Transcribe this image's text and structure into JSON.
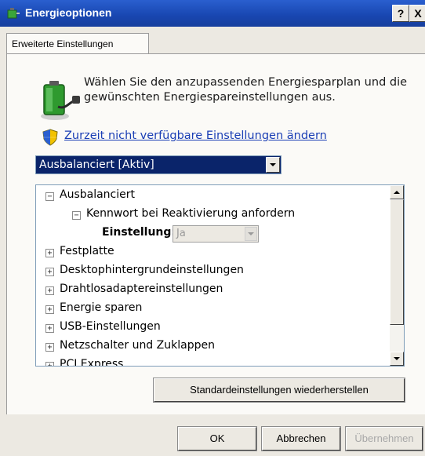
{
  "window": {
    "title": "Energieoptionen",
    "help_button": "?",
    "close_button": "X"
  },
  "tab": {
    "label": "Erweiterte Einstellungen"
  },
  "intro_text": "Wählen Sie den anzupassenden Energiesparplan und die gewünschten Energiespareinstellungen aus.",
  "link_text": "Zurzeit nicht verfügbare Einstellungen ändern",
  "plan_select": {
    "value": "Ausbalanciert [Aktiv]"
  },
  "tree": {
    "root": {
      "label": "Ausbalanciert",
      "expander": "−"
    },
    "child": {
      "label": "Kennwort bei Reaktivierung anfordern",
      "expander": "−"
    },
    "setting": {
      "label": "Einstellung:",
      "value": "Ja"
    },
    "items": [
      {
        "label": "Festplatte",
        "expander": "+"
      },
      {
        "label": "Desktophintergrundeinstellungen",
        "expander": "+"
      },
      {
        "label": "Drahtlosadaptereinstellungen",
        "expander": "+"
      },
      {
        "label": "Energie sparen",
        "expander": "+"
      },
      {
        "label": "USB-Einstellungen",
        "expander": "+"
      },
      {
        "label": "Netzschalter und Zuklappen",
        "expander": "+"
      },
      {
        "label": "PCI Express",
        "expander": "+"
      }
    ]
  },
  "buttons": {
    "restore": "Standardeinstellungen wiederherstellen",
    "ok": "OK",
    "cancel": "Abbrechen",
    "apply": "Übernehmen"
  },
  "icons": {
    "app": "power-options-icon",
    "battery": "battery-plug-icon",
    "shield": "uac-shield-icon"
  }
}
